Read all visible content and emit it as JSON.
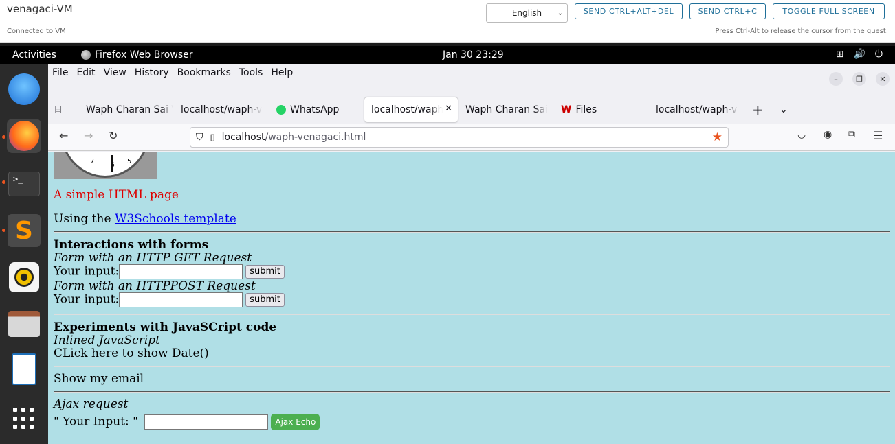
{
  "vm": {
    "title": "venagaci-VM",
    "status": "Connected to VM",
    "hint": "Press Ctrl-Alt to release the cursor from the guest.",
    "language": "English",
    "buttons": {
      "ctrl_alt_del": "SEND CTRL+ALT+DEL",
      "ctrl_c": "SEND CTRL+C",
      "fullscreen": "TOGGLE FULL SCREEN"
    }
  },
  "topbar": {
    "activities": "Activities",
    "app_name": "Firefox Web Browser",
    "clock": "Jan 30  23:29"
  },
  "dock": {
    "terminal_label": ">_"
  },
  "menubar": {
    "items": [
      "File",
      "Edit",
      "View",
      "History",
      "Bookmarks",
      "Tools",
      "Help"
    ]
  },
  "tabs": [
    {
      "label": "Waph Charan Sai V"
    },
    {
      "label": "localhost/waph-ve"
    },
    {
      "label": "WhatsApp"
    },
    {
      "label": "localhost/waph"
    },
    {
      "label": "Waph Charan Sai V"
    },
    {
      "label": "Files"
    },
    {
      "label": "localhost/waph-ve"
    }
  ],
  "urlbar": {
    "host": "localhost",
    "path": "/waph-venagaci.html"
  },
  "page": {
    "clock_numbers": {
      "left": "7",
      "right": "5",
      "bottom": "6"
    },
    "title": "A simple HTML page",
    "using_prefix": "Using the ",
    "template_link": "W3Schools template",
    "forms_heading": "Interactions with forms",
    "get_label": "Form with an HTTP GET Request",
    "input_label": "Your input:",
    "submit": "submit",
    "post_label": "Form with an HTTPPOST Request",
    "js_heading": "Experiments with JavaSCript code",
    "inline_js": "Inlined JavaScript",
    "click_date": "CLick here to show Date()",
    "show_email": "Show my email",
    "ajax_heading": "Ajax request",
    "ajax_input_label": "\" Your Input: \"",
    "ajax_button": "Ajax Echo"
  },
  "colors": {
    "page_bg": "#b0dfe6",
    "title_red": "#dd0000",
    "vm_button": "#1f6f99",
    "ajax_green": "#4caf50",
    "bookmark_star": "#e95420"
  }
}
